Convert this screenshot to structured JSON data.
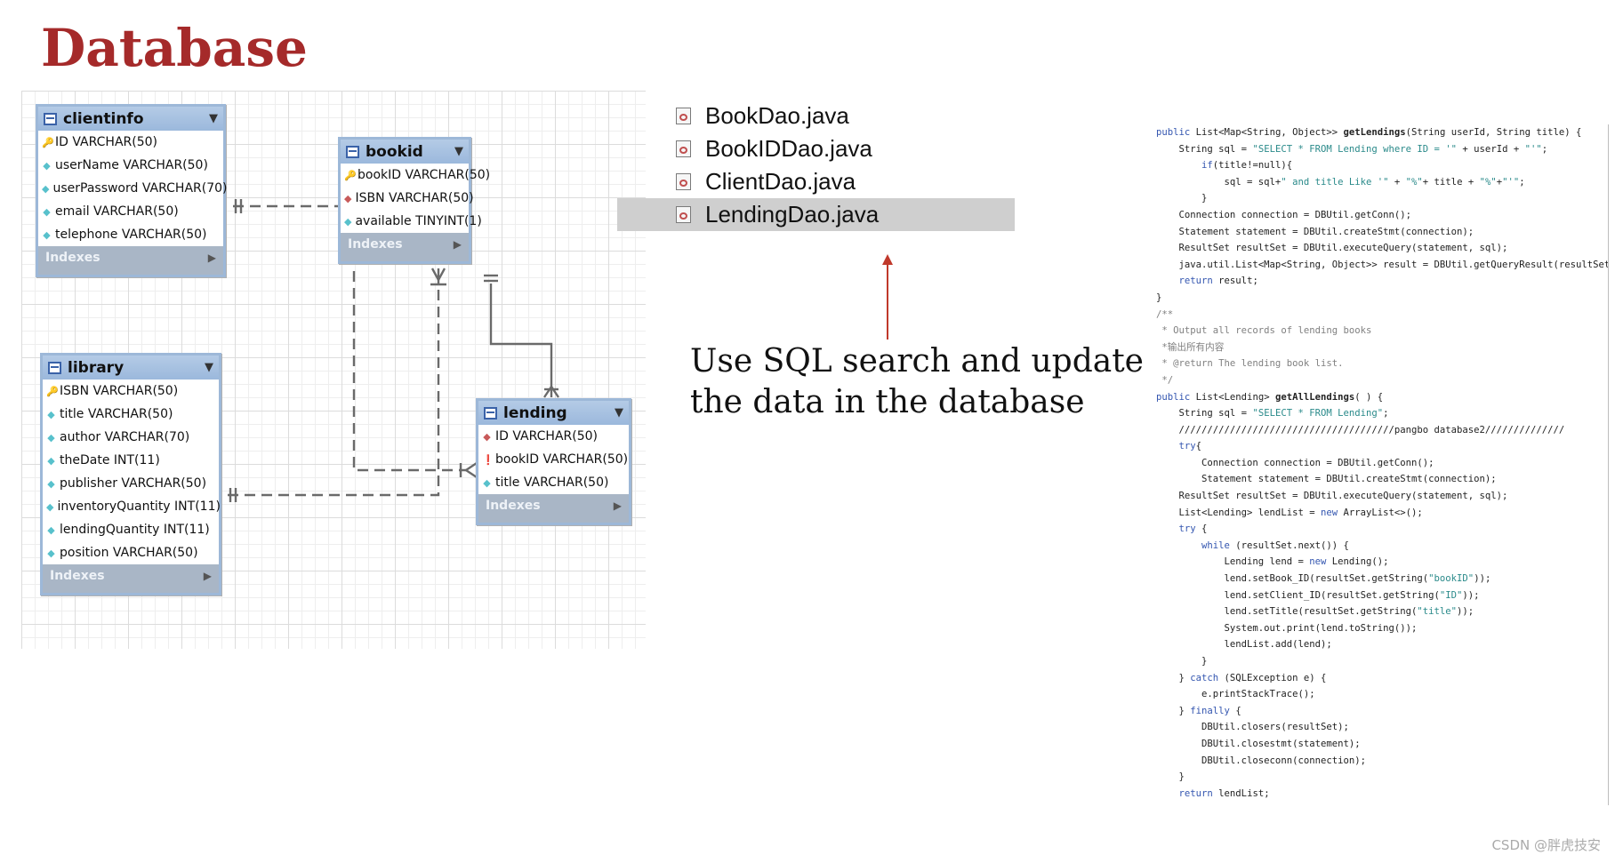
{
  "title": "Database",
  "er_diagram": {
    "tables": [
      {
        "name": "clientinfo",
        "fields": [
          {
            "icon": "key-icon",
            "text": "ID VARCHAR(50)"
          },
          {
            "icon": "diamond-icon",
            "text": "userName VARCHAR(50)"
          },
          {
            "icon": "diamond-icon",
            "text": "userPassword VARCHAR(70)"
          },
          {
            "icon": "diamond-icon",
            "text": "email VARCHAR(50)"
          },
          {
            "icon": "diamond-icon",
            "text": "telephone VARCHAR(50)"
          }
        ],
        "indexes": "Indexes"
      },
      {
        "name": "bookid",
        "fields": [
          {
            "icon": "key-icon",
            "text": "bookID VARCHAR(50)"
          },
          {
            "icon": "foreign-key-icon",
            "text": "ISBN VARCHAR(50)"
          },
          {
            "icon": "diamond-icon",
            "text": "available TINYINT(1)"
          }
        ],
        "indexes": "Indexes"
      },
      {
        "name": "library",
        "fields": [
          {
            "icon": "key-icon",
            "text": "ISBN VARCHAR(50)"
          },
          {
            "icon": "diamond-icon",
            "text": "title VARCHAR(50)"
          },
          {
            "icon": "diamond-icon",
            "text": "author VARCHAR(70)"
          },
          {
            "icon": "diamond-icon",
            "text": "theDate INT(11)"
          },
          {
            "icon": "diamond-icon",
            "text": "publisher VARCHAR(50)"
          },
          {
            "icon": "diamond-icon",
            "text": "inventoryQuantity INT(11)"
          },
          {
            "icon": "diamond-icon",
            "text": "lendingQuantity INT(11)"
          },
          {
            "icon": "diamond-icon",
            "text": "position VARCHAR(50)"
          }
        ],
        "indexes": "Indexes"
      },
      {
        "name": "lending",
        "fields": [
          {
            "icon": "foreign-key-icon",
            "text": "ID VARCHAR(50)"
          },
          {
            "icon": "red-key-icon",
            "text": "bookID VARCHAR(50)"
          },
          {
            "icon": "diamond-icon",
            "text": "title VARCHAR(50)"
          }
        ],
        "indexes": "Indexes"
      }
    ]
  },
  "files": [
    {
      "name": "BookDao.java",
      "selected": false
    },
    {
      "name": "BookIDDao.java",
      "selected": false
    },
    {
      "name": "ClientDao.java",
      "selected": false
    },
    {
      "name": "LendingDao.java",
      "selected": true
    }
  ],
  "note": {
    "line1": "Use SQL search and update",
    "line2": "the data in the database"
  },
  "code": [
    "public List<Map<String, Object>> getLendings(String userId, String title) {",
    "    String sql = \"SELECT * FROM Lending where ID = '\" + userId + \"'\";",
    "        if(title!=null){",
    "            sql = sql+\" and title Like '\" + \"%\"+ title + \"%\"+\"'\";",
    "        }",
    "    Connection connection = DBUtil.getConn();",
    "    Statement statement = DBUtil.createStmt(connection);",
    "    ResultSet resultSet = DBUtil.executeQuery(statement, sql);",
    "    java.util.List<Map<String, Object>> result = DBUtil.getQueryResult(resultSet);",
    "    return result;",
    "}",
    "/**",
    " * Output all records of lending books",
    " *输出所有内容",
    " * @return The lending book list.",
    " */",
    "public List<Lending> getAllLendings( ) {",
    "    String sql = \"SELECT * FROM Lending\";",
    "    //////////////////////////////////////pangbo database2//////////////",
    "    try{",
    "        Connection connection = DBUtil.getConn();",
    "        Statement statement = DBUtil.createStmt(connection);",
    "    ResultSet resultSet = DBUtil.executeQuery(statement, sql);",
    "    List<Lending> lendList = new ArrayList<>();",
    "    try {",
    "        while (resultSet.next()) {",
    "            Lending lend = new Lending();",
    "            lend.setBook_ID(resultSet.getString(\"bookID\"));",
    "            lend.setClient_ID(resultSet.getString(\"ID\"));",
    "            lend.setTitle(resultSet.getString(\"title\"));",
    "            System.out.print(lend.toString());",
    "            lendList.add(lend);",
    "        }",
    "    } catch (SQLException e) {",
    "        e.printStackTrace();",
    "    } finally {",
    "        DBUtil.closers(resultSet);",
    "        DBUtil.closestmt(statement);",
    "        DBUtil.closeconn(connection);",
    "    }",
    "    return lendList;"
  ],
  "watermark": "CSDN @胖虎技安"
}
